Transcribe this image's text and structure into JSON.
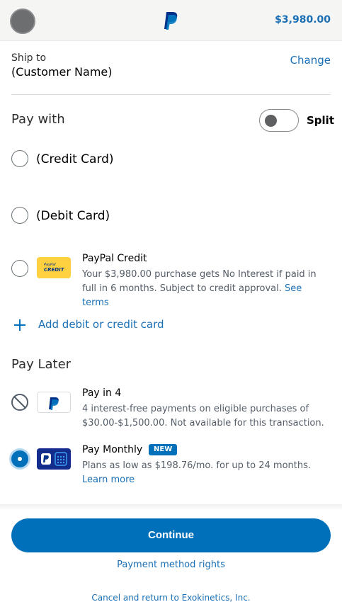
{
  "header": {
    "amount": "$3,980.00",
    "logo_icon": "paypal-logo-icon",
    "avatar_icon": "user-avatar"
  },
  "shipping": {
    "label": "Ship to",
    "name": "(Customer Name)",
    "change_label": "Change"
  },
  "pay_with": {
    "title": "Pay with",
    "split_label": "Split",
    "split_enabled": false,
    "options": [
      {
        "label": "(Credit Card)",
        "selected": false
      },
      {
        "label": "(Debit Card)",
        "selected": false
      }
    ],
    "paypal_credit": {
      "title": "PayPal Credit",
      "thumb_small": "PayPal",
      "thumb_big": "CREDIT",
      "desc": "Your $3,980.00 purchase gets No Interest if paid in full in 6 months. Subject to credit approval.",
      "see_terms": "See terms",
      "selected": false
    },
    "add_card_label": "Add debit or credit card"
  },
  "pay_later": {
    "title": "Pay Later",
    "pay_in_4": {
      "title": "Pay in 4",
      "desc": "4 interest-free payments on eligible purchases of $30.00-$1,500.00. Not available for this transaction.",
      "status": "disabled"
    },
    "pay_monthly": {
      "title": "Pay Monthly",
      "badge": "NEW",
      "desc": "Plans as low as $198.76/mo. for up to 24 months.",
      "learn_more": "Learn more",
      "selected": true
    }
  },
  "footer": {
    "continue_label": "Continue",
    "payment_rights": "Payment method rights",
    "cancel_label": "Cancel and return to Exokinetics, Inc."
  },
  "colors": {
    "accent": "#0070ba",
    "link": "#1a6fb5",
    "credit_yellow": "#ffd140",
    "monthly_navy": "#142c8e"
  }
}
